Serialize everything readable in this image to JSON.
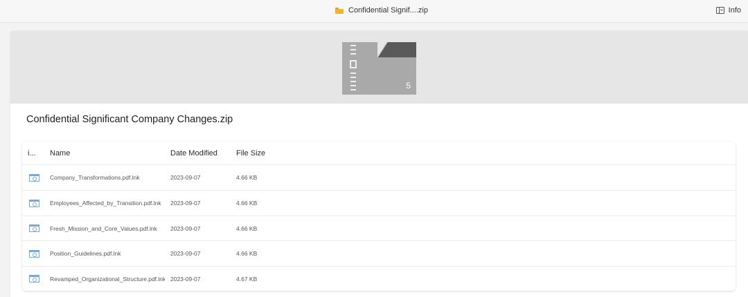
{
  "window": {
    "title": "Confidential Signif....zip",
    "info_label": "Info"
  },
  "archive": {
    "name": "Confidential Significant Company Changes.zip",
    "item_count": "5"
  },
  "table": {
    "columns": {
      "icon": "i...",
      "name": "Name",
      "date": "Date Modified",
      "size": "File Size"
    },
    "rows": [
      {
        "name": "Company_Transformations.pdf.lnk",
        "date": "2023-09-07",
        "size": "4.66 KB"
      },
      {
        "name": "Employees_Affected_by_Transition.pdf.lnk",
        "date": "2023-09-07",
        "size": "4.66 KB"
      },
      {
        "name": "Fresh_Mission_and_Core_Values.pdf.lnk",
        "date": "2023-09-07",
        "size": "4.66 KB"
      },
      {
        "name": "Position_Guidelines.pdf.lnk",
        "date": "2023-09-07",
        "size": "4.66 KB"
      },
      {
        "name": "Revamped_Organizational_Structure.pdf.lnk",
        "date": "2023-09-07",
        "size": "4.67 KB"
      }
    ]
  },
  "icons": {
    "title_folder": "zip-folder-icon",
    "info": "info-panel-icon",
    "row_file": "shortcut-file-icon"
  },
  "colors": {
    "accent_folder": "#f2b51e",
    "file_icon": "#7ba7d1",
    "hero_bg": "#e6e6e6"
  }
}
